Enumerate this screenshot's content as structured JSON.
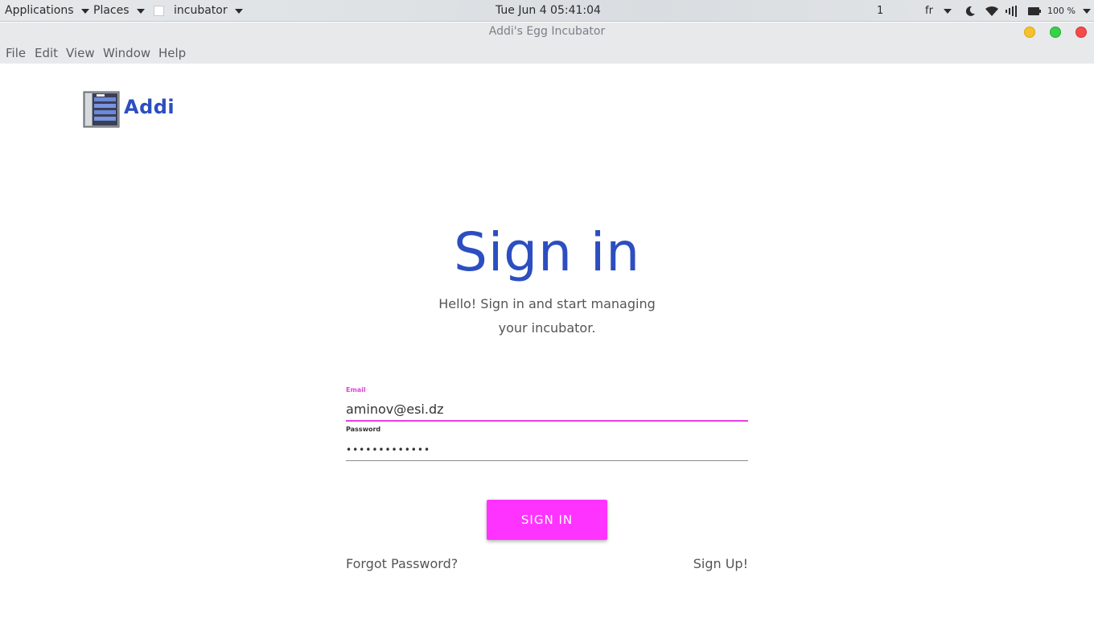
{
  "system_panel": {
    "applications_label": "Applications",
    "places_label": "Places",
    "active_app_label": "incubator",
    "clock": "Tue Jun 4  05:41:04",
    "workspace": "1",
    "language": "fr",
    "battery_percent": "100 %"
  },
  "window": {
    "title": "Addi's Egg Incubator"
  },
  "menu": {
    "items": [
      "File",
      "Edit",
      "View",
      "Window",
      "Help"
    ]
  },
  "app": {
    "brand_name": "Addi",
    "heading": "Sign in",
    "subtitle": "Hello! Sign in and start managing your incubator.",
    "email_label": "Email",
    "email_value": "aminov@esi.dz",
    "password_label": "Password",
    "password_value": "•••••••••••••",
    "signin_button_label": "SIGN IN",
    "forgot_password_label": "Forgot Password?",
    "signup_label": "Sign Up!"
  },
  "colors": {
    "brand_blue": "#2c4ec0",
    "accent_magenta": "#ff33ff",
    "focus_magenta": "#e63ee6"
  }
}
